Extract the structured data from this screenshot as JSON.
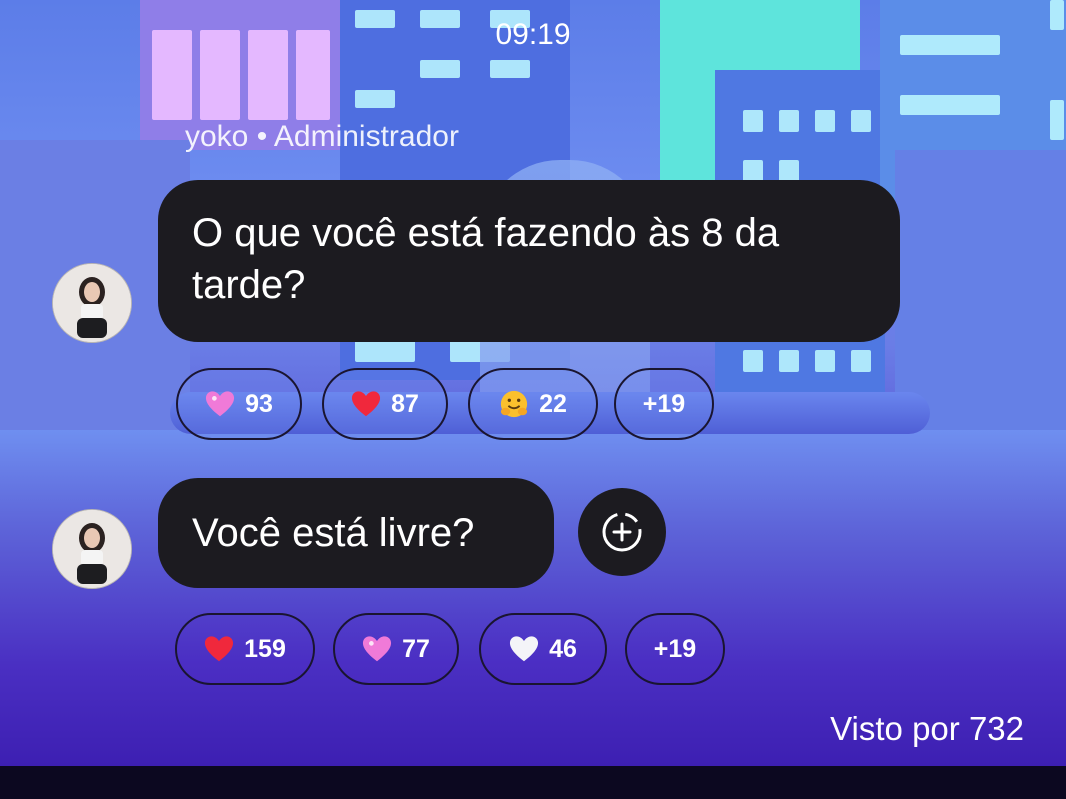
{
  "status_bar": {
    "time": "09:19"
  },
  "chat": {
    "sender_label": "yoko • Administrador",
    "messages": [
      {
        "text": "O que você está fazendo às 8 da tarde?",
        "reactions": [
          {
            "icon": "pink-sparkling-heart-icon",
            "count": "93"
          },
          {
            "icon": "red-heart-icon",
            "count": "87"
          },
          {
            "icon": "hugging-face-emoji-icon",
            "count": "22"
          },
          {
            "icon": "",
            "count": "+19"
          }
        ]
      },
      {
        "text": "Você está livre?",
        "reactions": [
          {
            "icon": "red-heart-icon",
            "count": "159"
          },
          {
            "icon": "pink-sparkling-heart-icon",
            "count": "77"
          },
          {
            "icon": "white-heart-icon",
            "count": "46"
          },
          {
            "icon": "",
            "count": "+19"
          }
        ]
      }
    ],
    "seen_by": "Visto por 732"
  },
  "colors": {
    "bubble": "#1c1b20",
    "red_heart": "#f0283c",
    "pink_heart": "#f07ad8",
    "white_heart": "#f4f4f8"
  }
}
